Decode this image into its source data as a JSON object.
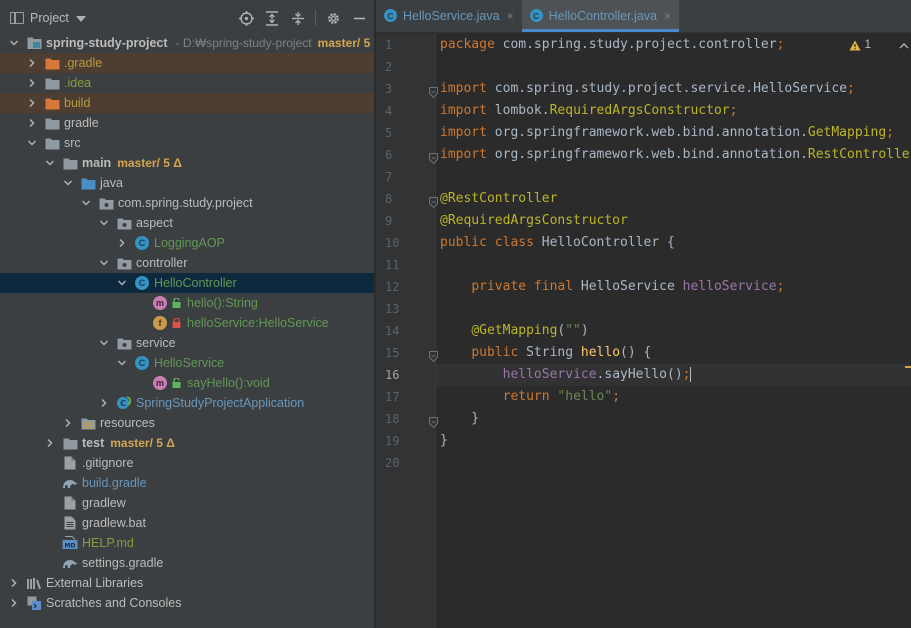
{
  "project_panel": {
    "title": "Project",
    "icons": [
      "locate-icon",
      "expand-all-icon",
      "collapse-all-icon",
      "gear-icon",
      "hide-icon"
    ],
    "tree": [
      {
        "depth": 0,
        "arrow": "down",
        "icon": "module",
        "label": "spring-study-project",
        "style": "bold",
        "extra": "- D:₩spring-study-project",
        "branch": "master/ 5"
      },
      {
        "depth": 1,
        "arrow": "right",
        "icon": "folder-orange",
        "label": ".gradle",
        "style": "orange",
        "row": "hl"
      },
      {
        "depth": 1,
        "arrow": "right",
        "icon": "folder",
        "label": ".idea",
        "style": "olive"
      },
      {
        "depth": 1,
        "arrow": "right",
        "icon": "folder-orange",
        "label": "build",
        "style": "orange",
        "row": "hl"
      },
      {
        "depth": 1,
        "arrow": "right",
        "icon": "folder",
        "label": "gradle",
        "style": ""
      },
      {
        "depth": 1,
        "arrow": "down",
        "icon": "folder",
        "label": "src",
        "style": ""
      },
      {
        "depth": 2,
        "arrow": "down",
        "icon": "folder",
        "label": "main",
        "style": "bold",
        "branch": "master/ 5 Δ"
      },
      {
        "depth": 3,
        "arrow": "down",
        "icon": "folder-blue",
        "label": "java",
        "style": ""
      },
      {
        "depth": 4,
        "arrow": "down",
        "icon": "package",
        "label": "com.spring.study.project",
        "style": ""
      },
      {
        "depth": 5,
        "arrow": "down",
        "icon": "package",
        "label": "aspect",
        "style": ""
      },
      {
        "depth": 6,
        "arrow": "right",
        "icon": "class",
        "label": "LoggingAOP",
        "style": "green"
      },
      {
        "depth": 5,
        "arrow": "down",
        "icon": "package",
        "label": "controller",
        "style": ""
      },
      {
        "depth": 6,
        "arrow": "down",
        "icon": "class",
        "label": "HelloController",
        "style": "green",
        "row": "sel"
      },
      {
        "depth": 7,
        "arrow": "none",
        "icon": "method",
        "label": "hello():String",
        "style": "green",
        "vis": "public"
      },
      {
        "depth": 7,
        "arrow": "none",
        "icon": "field",
        "label": "helloService:HelloService",
        "style": "green",
        "vis": "private"
      },
      {
        "depth": 5,
        "arrow": "down",
        "icon": "package",
        "label": "service",
        "style": ""
      },
      {
        "depth": 6,
        "arrow": "down",
        "icon": "class",
        "label": "HelloService",
        "style": "green"
      },
      {
        "depth": 7,
        "arrow": "none",
        "icon": "method",
        "label": "sayHello():void",
        "style": "green",
        "vis": "public"
      },
      {
        "depth": 5,
        "arrow": "right",
        "icon": "spring-class",
        "label": "SpringStudyProjectApplication",
        "style": "blue"
      },
      {
        "depth": 3,
        "arrow": "right",
        "icon": "resources",
        "label": "resources",
        "style": ""
      },
      {
        "depth": 2,
        "arrow": "right",
        "icon": "folder",
        "label": "test",
        "style": "bold",
        "branch": "master/ 5 Δ"
      },
      {
        "depth": 2,
        "arrow": "none",
        "icon": "file",
        "label": ".gitignore",
        "style": ""
      },
      {
        "depth": 2,
        "arrow": "none",
        "icon": "gradle",
        "label": "build.gradle",
        "style": "blue"
      },
      {
        "depth": 2,
        "arrow": "none",
        "icon": "file",
        "label": "gradlew",
        "style": ""
      },
      {
        "depth": 2,
        "arrow": "none",
        "icon": "file-lines",
        "label": "gradlew.bat",
        "style": ""
      },
      {
        "depth": 2,
        "arrow": "none",
        "icon": "markdown",
        "label": "HELP.md",
        "style": "olive"
      },
      {
        "depth": 2,
        "arrow": "none",
        "icon": "gradle",
        "label": "settings.gradle",
        "style": ""
      },
      {
        "depth": 0,
        "arrow": "right",
        "icon": "libraries",
        "label": "External Libraries",
        "style": ""
      },
      {
        "depth": 0,
        "arrow": "right",
        "icon": "scratches",
        "label": "Scratches and Consoles",
        "style": ""
      }
    ]
  },
  "editor": {
    "tabs": [
      {
        "label": "HelloService.java",
        "active": false,
        "close": "×"
      },
      {
        "label": "HelloController.java",
        "active": true,
        "close": "×"
      }
    ],
    "warning_count": "1",
    "current_line": 16,
    "lines": [
      [
        [
          "kw",
          "package "
        ],
        [
          "txt",
          "com.spring.study.project.controller"
        ],
        [
          "kw",
          ";"
        ]
      ],
      [],
      [
        [
          "kw",
          "import "
        ],
        [
          "txt",
          "com.spring.study.project.service.HelloService"
        ],
        [
          "kw",
          ";"
        ]
      ],
      [
        [
          "kw",
          "import "
        ],
        [
          "txt",
          "lombok."
        ],
        [
          "ann",
          "RequiredArgsConstructor"
        ],
        [
          "kw",
          ";"
        ]
      ],
      [
        [
          "kw",
          "import "
        ],
        [
          "txt",
          "org.springframework.web.bind.annotation."
        ],
        [
          "ann",
          "GetMapping"
        ],
        [
          "kw",
          ";"
        ]
      ],
      [
        [
          "kw",
          "import "
        ],
        [
          "txt",
          "org.springframework.web.bind.annotation."
        ],
        [
          "ann",
          "RestController"
        ],
        [
          "kw",
          ";"
        ]
      ],
      [],
      [
        [
          "ann",
          "@RestController"
        ]
      ],
      [
        [
          "ann",
          "@RequiredArgsConstructor"
        ]
      ],
      [
        [
          "kw",
          "public class "
        ],
        [
          "txt",
          "HelloController {"
        ]
      ],
      [],
      [
        [
          "txt",
          "    "
        ],
        [
          "kw",
          "private final "
        ],
        [
          "txt",
          "HelloService "
        ],
        [
          "fld",
          "helloService"
        ],
        [
          "kw",
          ";"
        ]
      ],
      [],
      [
        [
          "txt",
          "    "
        ],
        [
          "ann",
          "@GetMapping"
        ],
        [
          "txt",
          "("
        ],
        [
          "str",
          "\"\""
        ],
        [
          "txt",
          ")"
        ]
      ],
      [
        [
          "txt",
          "    "
        ],
        [
          "kw",
          "public "
        ],
        [
          "txt",
          "String "
        ],
        [
          "mcall",
          "hello"
        ],
        [
          "txt",
          "() {"
        ]
      ],
      [
        [
          "txt",
          "        "
        ],
        [
          "fld",
          "helloService"
        ],
        [
          "txt",
          ".sayHello()"
        ],
        [
          "kw",
          ";"
        ],
        [
          "caret",
          ""
        ]
      ],
      [
        [
          "txt",
          "        "
        ],
        [
          "kw",
          "return "
        ],
        [
          "str",
          "\"hello\""
        ],
        [
          "kw",
          ";"
        ]
      ],
      [
        [
          "txt",
          "    }"
        ]
      ],
      [
        [
          "txt",
          "}"
        ]
      ],
      []
    ],
    "fold_lines": [
      3,
      6,
      8,
      15,
      18
    ]
  },
  "colors": {
    "panel_bg": "#3c3f41",
    "editor_bg": "#2b2b2b",
    "selection": "#0d293e",
    "keyword": "#cc7832",
    "annotation": "#bbb529",
    "field": "#9876aa",
    "string": "#6a8759"
  }
}
